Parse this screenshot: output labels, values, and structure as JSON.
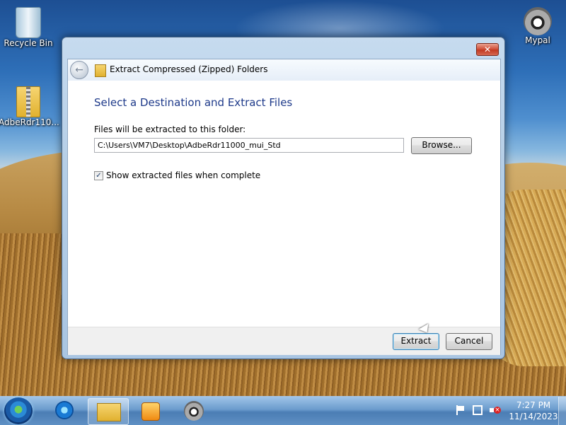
{
  "desktop": {
    "icons": [
      {
        "label": "Recycle Bin",
        "icon": "recycle-bin-icon"
      },
      {
        "label": "AdbeRdr110...",
        "icon": "zip-folder-icon"
      },
      {
        "label": "Mypal",
        "icon": "mypal-browser-icon"
      }
    ]
  },
  "dialog": {
    "title": "Extract Compressed (Zipped) Folders",
    "close_label": "✕",
    "heading": "Select a Destination and Extract Files",
    "path_label": "Files will be extracted to this folder:",
    "path_value": "C:\\Users\\VM7\\Desktop\\AdbeRdr11000_mui_Std",
    "browse_label": "Browse...",
    "checkbox_label": "Show extracted files when complete",
    "checkbox_checked": true,
    "checkbox_mark": "✓",
    "extract_label": "Extract",
    "cancel_label": "Cancel",
    "back_glyph": "←"
  },
  "taskbar": {
    "items": [
      {
        "name": "start-button"
      },
      {
        "name": "internet-explorer",
        "icon": "ie-icon"
      },
      {
        "name": "windows-explorer",
        "icon": "folder-icon",
        "active": true
      },
      {
        "name": "media-player",
        "icon": "media-player-icon"
      },
      {
        "name": "mypal",
        "icon": "raccoon-icon"
      }
    ],
    "clock_time": "7:27 PM",
    "clock_date": "11/14/2023"
  }
}
